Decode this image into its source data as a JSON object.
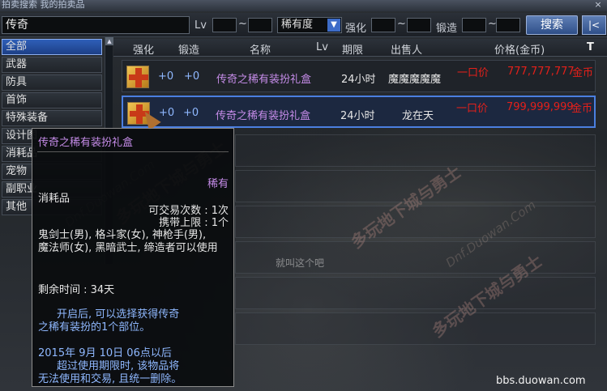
{
  "titlebar": {
    "text": "拍卖搜索 我的拍卖品",
    "close": "×"
  },
  "search": {
    "keyword": "传奇",
    "lv_label": "Lv",
    "tilde": "~",
    "rarity_select": "稀有度",
    "enhance_label": "强化",
    "forge_label": "锻造",
    "search_button": "搜索",
    "next_button": "|<"
  },
  "sidebar": {
    "items": [
      {
        "label": "全部"
      },
      {
        "label": "武器"
      },
      {
        "label": "防具"
      },
      {
        "label": "首饰"
      },
      {
        "label": "特殊装备"
      },
      {
        "label": "设计图"
      },
      {
        "label": "消耗品"
      },
      {
        "label": "宠物"
      },
      {
        "label": "副职业"
      },
      {
        "label": "其他"
      }
    ]
  },
  "columns": {
    "enhance": "强化",
    "forge": "锻造",
    "name": "名称",
    "lv": "Lv",
    "duration": "期限",
    "seller": "出售人",
    "price": "价格(金币)",
    "sort_icon": "T"
  },
  "rows": [
    {
      "enhance": "+0",
      "forge": "+0",
      "name": "传奇之稀有装扮礼盒",
      "duration": "24小时",
      "seller": "魔魔魔魔魔",
      "buyout": "一口价",
      "price": "777,777,777",
      "currency": "金币"
    },
    {
      "enhance": "+0",
      "forge": "+0",
      "name": "传奇之稀有装扮礼盒",
      "duration": "24小时",
      "seller": "龙在天",
      "buyout": "一口价",
      "price": "799,999,999",
      "currency": "金币"
    }
  ],
  "tooltip": {
    "title": "传奇之稀有装扮礼盒",
    "rarity": "稀有",
    "category": "消耗品",
    "trade_count": "可交易次数 : 1次",
    "carry_limit": "携带上限 : 1个",
    "classes_line1": "鬼剑士(男), 格斗家(女), 神枪手(男),",
    "classes_line2": "魔法师(女), 黑暗武士, 缔造者可以使用",
    "remaining": "剩余时间 : 34天",
    "desc_line1": "开启后, 可以选择获得传奇",
    "desc_line2": "之稀有装扮的1个部位。",
    "date": "2015年 9月 10日 06点以后",
    "expire_line1": "超过使用期限时, 该物品将",
    "expire_line2": "无法使用和交易, 且统一删除。"
  },
  "background_text": "就叫这个吧",
  "watermark": {
    "main": "多玩地下城与勇士",
    "sub": "Dnf.Duowan.Com"
  },
  "site": "bbs.duowan.com"
}
